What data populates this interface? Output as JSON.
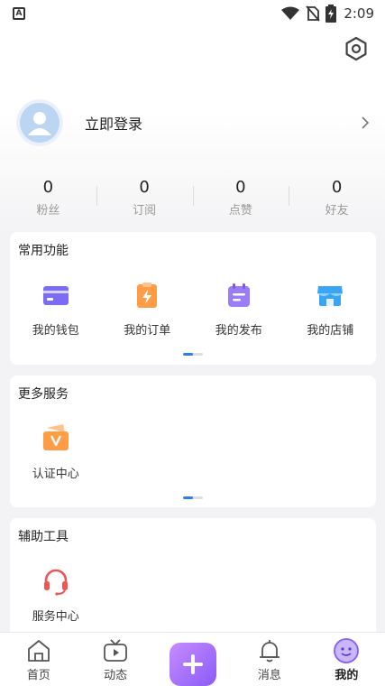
{
  "status_bar": {
    "time": "2:09",
    "app_badge": "A"
  },
  "profile": {
    "login_text": "立即登录"
  },
  "stats": [
    {
      "value": "0",
      "label": "粉丝"
    },
    {
      "value": "0",
      "label": "订阅"
    },
    {
      "value": "0",
      "label": "点赞"
    },
    {
      "value": "0",
      "label": "好友"
    }
  ],
  "common_functions": {
    "title": "常用功能",
    "items": [
      {
        "label": "我的钱包",
        "icon": "wallet-icon"
      },
      {
        "label": "我的订单",
        "icon": "order-icon"
      },
      {
        "label": "我的发布",
        "icon": "publish-icon"
      },
      {
        "label": "我的店铺",
        "icon": "shop-icon"
      }
    ]
  },
  "more_services": {
    "title": "更多服务",
    "items": [
      {
        "label": "认证中心",
        "icon": "verify-icon"
      }
    ]
  },
  "tools": {
    "title": "辅助工具",
    "items": [
      {
        "label": "服务中心",
        "icon": "headset-icon"
      }
    ]
  },
  "tabbar": {
    "items": [
      {
        "label": "首页",
        "icon": "home-icon"
      },
      {
        "label": "动态",
        "icon": "tv-icon"
      },
      {
        "label": "",
        "icon": "plus-icon"
      },
      {
        "label": "消息",
        "icon": "bell-icon"
      },
      {
        "label": "我的",
        "icon": "smile-icon",
        "active": true
      }
    ]
  },
  "colors": {
    "accent": "#2f7cf6",
    "plus_gradient_start": "#c78bff",
    "plus_gradient_end": "#8a5cf6",
    "wallet": "#7b6cf6",
    "order": "#ff9d47",
    "publish": "#9b7cf6",
    "shop": "#3aa5f5",
    "verify": "#ff9d47",
    "headset": "#f05454"
  }
}
